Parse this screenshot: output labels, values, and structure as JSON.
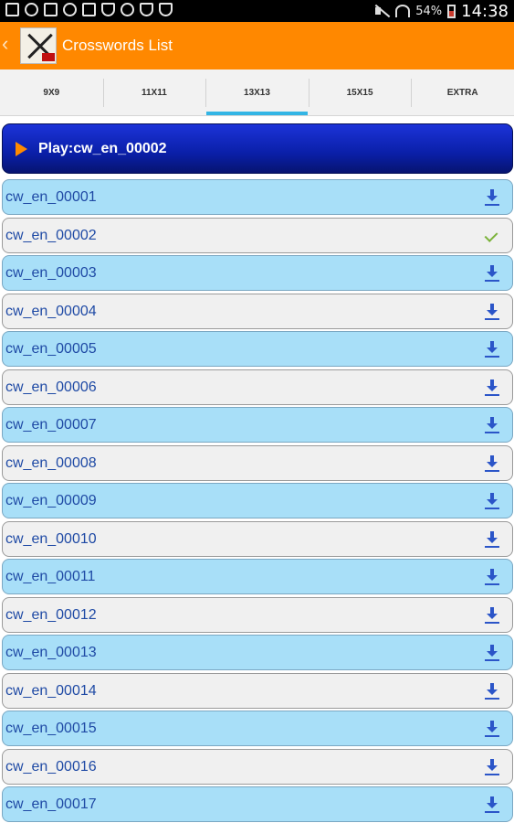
{
  "status_bar": {
    "battery": "54%",
    "time": "14:38"
  },
  "action_bar": {
    "title": "Crosswords List"
  },
  "tabs": [
    {
      "label": "9X9",
      "selected": false
    },
    {
      "label": "11X11",
      "selected": false
    },
    {
      "label": "13X13",
      "selected": true
    },
    {
      "label": "15X15",
      "selected": false
    },
    {
      "label": "EXTRA",
      "selected": false
    }
  ],
  "play": {
    "label": "Play:cw_en_00002"
  },
  "list": [
    {
      "name": "cw_en_00001",
      "icon": "download-icon"
    },
    {
      "name": "cw_en_00002",
      "icon": "check-icon"
    },
    {
      "name": "cw_en_00003",
      "icon": "download-icon"
    },
    {
      "name": "cw_en_00004",
      "icon": "download-icon"
    },
    {
      "name": "cw_en_00005",
      "icon": "download-icon"
    },
    {
      "name": "cw_en_00006",
      "icon": "download-icon"
    },
    {
      "name": "cw_en_00007",
      "icon": "download-icon"
    },
    {
      "name": "cw_en_00008",
      "icon": "download-icon"
    },
    {
      "name": "cw_en_00009",
      "icon": "download-icon"
    },
    {
      "name": "cw_en_00010",
      "icon": "download-icon"
    },
    {
      "name": "cw_en_00011",
      "icon": "download-icon"
    },
    {
      "name": "cw_en_00012",
      "icon": "download-icon"
    },
    {
      "name": "cw_en_00013",
      "icon": "download-icon"
    },
    {
      "name": "cw_en_00014",
      "icon": "download-icon"
    },
    {
      "name": "cw_en_00015",
      "icon": "download-icon"
    },
    {
      "name": "cw_en_00016",
      "icon": "download-icon"
    },
    {
      "name": "cw_en_00017",
      "icon": "download-icon"
    }
  ],
  "colors": {
    "action_bar": "#ff8800",
    "row_alt": "#a8dff8",
    "row_plain": "#f0f0f0",
    "play_button": "#0a1fa8",
    "tab_indicator": "#33b5e5"
  }
}
